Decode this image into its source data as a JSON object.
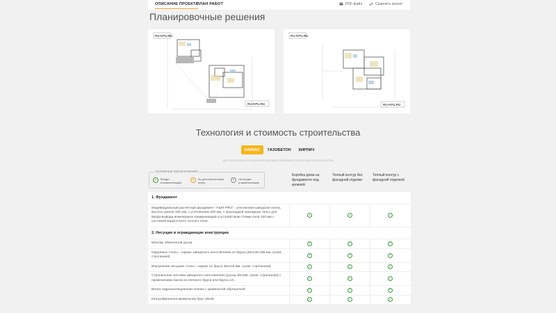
{
  "nav": {
    "tabs": [
      "ОПИСАНИЕ ПРОЕКТА",
      "ПЛАН РАБОТ"
    ],
    "pdf": "PDF-файл",
    "compare": "Сравнить проект"
  },
  "plans_title": "Планировочные решения",
  "plan_watermarks": [
    "RU-KPU.RU",
    "RU-KPU.RU"
  ],
  "tech_title": "Технология и стоимость строительства",
  "materials": [
    "КАРКАС",
    "ГАЗОБЕТОН",
    "КИРПИЧ"
  ],
  "hint": "Для просмотра состава комплектаций выберите технологию строительства",
  "legend": {
    "title": "УСЛОВНЫЕ ОБОЗНАЧЕНИЯ",
    "items": [
      {
        "icon": "check-icon",
        "text1": "Входит",
        "text2": "в комплектацию"
      },
      {
        "icon": "plus-icon",
        "text1": "За дополнительную",
        "text2": "плату"
      },
      {
        "icon": "cross-icon",
        "text1": "Не входит",
        "text2": "в комплектацию"
      }
    ]
  },
  "columns": [
    "Коробка дома на фундаменте под кровлей",
    "Теплый контур без фасадной отделки",
    "Теплый контур с фасадной отделкой"
  ],
  "colors": {
    "accent": "#f5b51b",
    "check": "#3c9b3c"
  },
  "rows": [
    {
      "type": "section",
      "text": "1. Фундамент"
    },
    {
      "type": "item",
      "text": "Индивидуальный расчётный фундамент \"УШП PRO\" - утепленная шведская плита, высота цоколя 320 мм, с утеплением 200 мм, с прокладкой закладных гильз для ввода-вывода инженерных коммуникаций и устройством стяжки пола 120 мм с системой жидкостного теплого пола",
      "c": [
        1,
        1,
        1
      ]
    },
    {
      "type": "section",
      "text": "2. Несущие и ограждающие конструкции"
    },
    {
      "type": "item",
      "text": "Монтаж обвязочной доски",
      "c": [
        1,
        1,
        1
      ]
    },
    {
      "type": "item",
      "text": "Наружные стены – каркас заводского изготовления из бруса (45х145-195 мм, сухая, строганная).",
      "c": [
        1,
        1,
        1
      ]
    },
    {
      "type": "item",
      "text": "Внутренние несущие стены – каркас из бруса 45х145 мм, сухая, строганная).",
      "c": [
        1,
        1,
        1
      ]
    },
    {
      "type": "item",
      "text": "Стропильная система заводского изготовления (доска 45х195, сухая, строганная) с применением балок из клееного бруса или бруса LVL.",
      "c": [
        1,
        1,
        1
      ]
    },
    {
      "type": "item",
      "text": "Ветро-гидроизоляционная пленка с кровельной обрешеткой",
      "c": [
        1,
        1,
        1
      ]
    },
    {
      "type": "item",
      "text": "Контробрешетка кровельная брус 45х45",
      "c": [
        1,
        1,
        1
      ]
    }
  ]
}
